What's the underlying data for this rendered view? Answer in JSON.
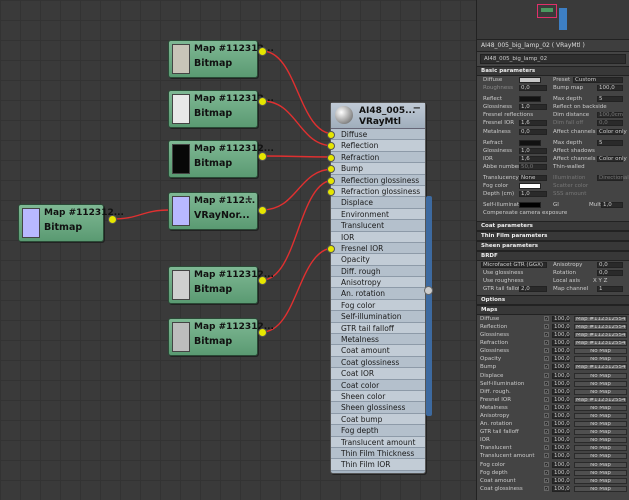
{
  "canvas": {
    "bitmap_nodes": [
      {
        "id": "bmp1",
        "title": "Map #112312...",
        "type": "Bitmap",
        "thumb": "#c8c4b8"
      },
      {
        "id": "bmp2",
        "title": "Map #112312...",
        "type": "Bitmap",
        "thumb": "#e8e8e8"
      },
      {
        "id": "bmp3",
        "title": "Map #112312...",
        "type": "Bitmap",
        "thumb": "#080808"
      },
      {
        "id": "bmp4",
        "title": "Map #112312...",
        "type": "Bitmap",
        "thumb": "#d8d8d8"
      },
      {
        "id": "bmp5",
        "title": "Map #112312...",
        "type": "Bitmap",
        "thumb": "#cfcfcf"
      },
      {
        "id": "bmp6",
        "title": "Map #112312...",
        "type": "Bitmap",
        "thumb": "#bdbdbd"
      }
    ],
    "normal_node": {
      "title": "Map #112...",
      "type": "VRayNor...",
      "plus": "+",
      "thumb": "#b8b8ff"
    },
    "material_node": {
      "title": "AI48_005...",
      "type": "VRayMtl",
      "minus": "−"
    },
    "slots": [
      "Diffuse",
      "Reflection",
      "Refraction",
      "Bump",
      "Reflection glossiness",
      "Refraction glossiness",
      "Displace",
      "Environment",
      "Translucent",
      "IOR",
      "Fresnel IOR",
      "Opacity",
      "Diff. rough",
      "Anisotropy",
      "An. rotation",
      "Fog color",
      "Self-illumination",
      "GTR tail falloff",
      "Metalness",
      "Coat amount",
      "Coat glossiness",
      "Coat IOR",
      "Coat color",
      "Sheen color",
      "Sheen glossiness",
      "Coat bump",
      "Fog depth",
      "Translucent amount",
      "Thin Film Thickness",
      "Thin Film IOR"
    ],
    "wire_color": "#e03030"
  },
  "panel": {
    "title": "AI48_005_big_lamp_02  ( VRayMtl )",
    "material_name": "AI48_005_big_lamp_02",
    "basic_header": "Basic parameters",
    "basic": {
      "diffuse": "Diffuse",
      "roughness": "Roughness",
      "roughness_val": "0,0",
      "preset": "Preset",
      "preset_val": "Custom",
      "bump_map": "Bump map",
      "bump_val": "100,0",
      "reflect": "Reflect",
      "max_depth": "Max depth",
      "max_depth_val": "5",
      "glossiness": "Glossiness",
      "glossiness_val": "1,0",
      "reflect_backside": "Reflect on backside",
      "fresnel": "Fresnel reflections",
      "dim_distance": "Dim distance",
      "dim_val": "100,0cm",
      "fresnel_ior": "Fresnel IOR",
      "fresnel_ior_val": "1,6",
      "dim_falloff": "Dim fall off",
      "dim_falloff_val": "0,0",
      "metalness": "Metalness",
      "metalness_val": "0,0",
      "affect_channels": "Affect channels",
      "color_only": "Color only",
      "refract": "Refract",
      "max_depth2_val": "5",
      "glossiness2_val": "1,0",
      "affect_shadows": "Affect shadows",
      "ior": "IOR",
      "ior_val": "1,6",
      "affect_channels2": "Affect channels",
      "color_only2": "Color only",
      "abbe": "Abbe number",
      "abbe_val": "50,0",
      "thin_walled": "Thin-walled",
      "translucency": "Translucency",
      "translucency_val": "None",
      "illumination": "Illumination",
      "directional": "Directional",
      "fog_color": "Fog color",
      "scatter_color": "Scatter color",
      "depth": "Depth (cm)",
      "depth_val": "1,0",
      "sss_amount": "SSS amount",
      "self_illum": "Self-illumination",
      "gi": "GI",
      "mult": "Mult",
      "mult_val": "1,0",
      "compensate": "Compensate camera exposure"
    },
    "collapsed": [
      "Coat parameters",
      "Thin Film parameters",
      "Sheen parameters"
    ],
    "brdf_header": "BRDF",
    "brdf": {
      "model": "Microfacet GTR (GGX)",
      "anisotropy": "Anisotropy",
      "anisotropy_val": "0,0",
      "use_glossiness": "Use glossiness",
      "rotation": "Rotation",
      "rotation_val": "0,0",
      "use_roughness": "Use roughness",
      "local_axis": "Local axis",
      "axes": "X  Y  Z",
      "gtr": "GTR tail falloff",
      "gtr_val": "2,0",
      "map_channel": "Map channel",
      "map_channel_val": "1"
    },
    "options_header": "Options",
    "maps_header": "Maps",
    "maps": [
      {
        "name": "Diffuse",
        "amount": "100,0",
        "map": "Map #1123125545 (..."
      },
      {
        "name": "Reflection",
        "amount": "100,0",
        "map": "Map #1123125544 (..."
      },
      {
        "name": "Glossiness",
        "amount": "100,0",
        "map": "Map #1123125541 (..."
      },
      {
        "name": "Refraction",
        "amount": "100,0",
        "map": "Map #1123125543 (..."
      },
      {
        "name": "Glossiness",
        "amount": "100,0",
        "map": "No Map"
      },
      {
        "name": "Opacity",
        "amount": "100,0",
        "map": "No Map"
      },
      {
        "name": "Bump",
        "amount": "100,0",
        "map": "Map #1123125546 ..."
      },
      {
        "name": "Displace",
        "amount": "100,0",
        "map": "No Map"
      },
      {
        "name": "Self-illumination",
        "amount": "100,0",
        "map": "No Map"
      },
      {
        "name": "Diff. rough.",
        "amount": "100,0",
        "map": "No Map"
      },
      {
        "name": "Fresnel IOR",
        "amount": "100,0",
        "map": "Map #1123125542 (..."
      },
      {
        "name": "Metalness",
        "amount": "100,0",
        "map": "No Map"
      },
      {
        "name": "Anisotropy",
        "amount": "100,0",
        "map": "No Map"
      },
      {
        "name": "An. rotation",
        "amount": "100,0",
        "map": "No Map"
      },
      {
        "name": "GTR tail falloff",
        "amount": "100,0",
        "map": "No Map"
      },
      {
        "name": "IOR",
        "amount": "100,0",
        "map": "No Map"
      },
      {
        "name": "Translucent",
        "amount": "100,0",
        "map": "No Map"
      },
      {
        "name": "Translucent amount",
        "amount": "100,0",
        "map": "No Map"
      },
      {
        "name": "Fog color",
        "amount": "100,0",
        "map": "No Map"
      },
      {
        "name": "Fog depth",
        "amount": "100,0",
        "map": "No Map"
      },
      {
        "name": "Coat amount",
        "amount": "100,0",
        "map": "No Map"
      },
      {
        "name": "Coat glossiness",
        "amount": "100,0",
        "map": "No Map"
      }
    ]
  }
}
